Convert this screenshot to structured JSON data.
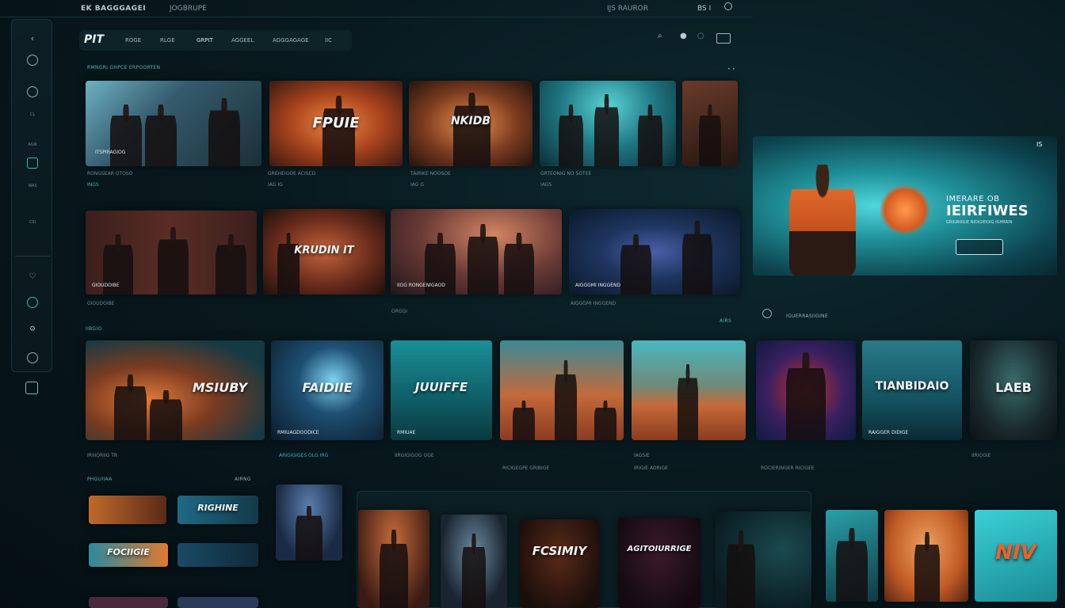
{
  "topbar": {
    "brand": "EK BAGGGAGEI",
    "item2": "JOGBRUPE",
    "item3": "IJS RAUROR",
    "item4": "BS I"
  },
  "sidebar": {
    "items": [
      {
        "label": ""
      },
      {
        "label": ""
      },
      {
        "label": "CL"
      },
      {
        "label": "AGN"
      },
      {
        "label": ""
      },
      {
        "label": "WAS"
      },
      {
        "label": "CSI"
      },
      {
        "label": ""
      },
      {
        "label": ""
      },
      {
        "label": ""
      },
      {
        "label": ""
      },
      {
        "label": ""
      }
    ]
  },
  "navbar": {
    "logo": "PIT",
    "tabs": [
      "ROGE",
      "RLGE",
      "GRPIT",
      "AGGEEL",
      "AGGGAGAGE",
      "IIC"
    ]
  },
  "sections": {
    "row1": "RMNGRI GHPCE ERPOORTEN",
    "row3": "IIBGIO",
    "row3_right": "AIRS",
    "row4": "PHGUIIAA",
    "row4_right": "AIRNG",
    "hero_side": "IGUERRASIIGINE"
  },
  "cards": {
    "r1c1_cap": "ITSPIRAGIOG",
    "r1c2_title": "FPUIE",
    "r1c3_title": "NKIDB",
    "r2c2_title": "KRUDIN IT",
    "r3c1_title": "MSIUBY",
    "r3c2_title": "FAIDIIE",
    "r3c3_title": "JUUIFFE",
    "r3c7_title": "TIANBIDAIO",
    "r3c8_title": "LAEB",
    "r3c2_cap": "RMIUAGDOODICE",
    "r3c3_cap": "RMIUAE",
    "r3c7_cap": "RAIGGER DIDIGE",
    "p1_title": "RIGHINE",
    "p2_title": "FOCIIGIE",
    "p6_title": "FCSIMIY",
    "p7_title": "AGITOIURRIGE",
    "p10_title": "NIV"
  },
  "meta": {
    "r1c1": "RONGSEAR OTOSO",
    "r1c1b": "INGS",
    "r1c2": "GREHEIGOE ACISCD",
    "r1c2b": "IAG IG",
    "r1c3": "TAIRIKE NOOSOE",
    "r1c3b": "IAG G",
    "r1c4": "GRTEONIG NO SOTEE",
    "r1c4b": "IAGS",
    "r2c1": "GIOUDOIBE",
    "r2c3": "IIGG RONGENIGAOD",
    "r2c3b": "ORGGI",
    "r2c4": "AIGGGMI INGGEND",
    "r3c1": "IRIIIORIIG TR",
    "r3c2": "ARIGIGIGES OLG IRG",
    "r3c3": "IIRGIGIGOG OGE",
    "r3c4": "RICIGEGPE GRIBIGE",
    "r3c5": "IAGSIE",
    "r3c6": "IRIGIE AORIGE",
    "r3c7": "ROCIERINGER RICIGEE",
    "r3c8": "IIRIOGIE"
  },
  "hero": {
    "title1": "IMERARE OB",
    "title2": "IEIRFIWES",
    "sub": "GRIGRIIIGIE NIDIGIEIOIG IGHRRIN",
    "close": "IS"
  },
  "colors": {
    "accent": "#2fb8b6",
    "bg": "#081a1f"
  }
}
